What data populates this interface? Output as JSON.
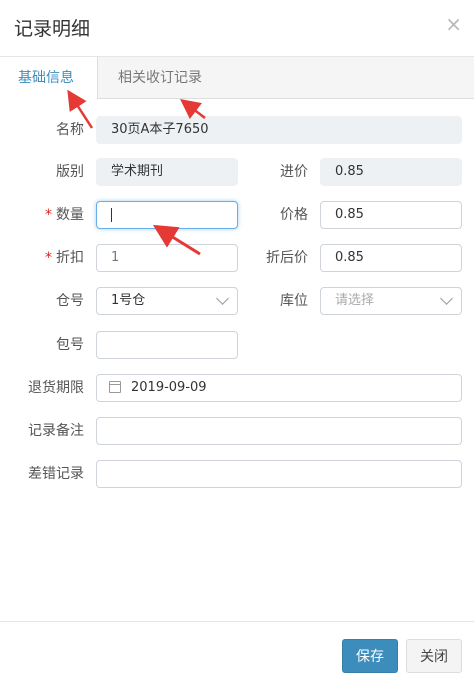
{
  "dialog": {
    "title": "记录明细",
    "close_glyph": "×"
  },
  "tabs": [
    {
      "label": "基础信息",
      "active": true
    },
    {
      "label": "相关收订记录",
      "active": false
    }
  ],
  "form": {
    "name_label": "名称",
    "name_value": "30页A本子7650",
    "edition_label": "版别",
    "edition_value": "学术期刊",
    "purchase_price_label": "进价",
    "purchase_price_value": "0.85",
    "required_mark": "*",
    "quantity_label": "数量",
    "quantity_value": "",
    "price_label": "价格",
    "price_value": "0.85",
    "discount_label": "折扣",
    "discount_value": "1",
    "discounted_price_label": "折后价",
    "discounted_price_value": "0.85",
    "warehouse_label": "仓号",
    "warehouse_value": "1号仓",
    "location_label": "库位",
    "location_placeholder": "请选择",
    "package_label": "包号",
    "package_value": "",
    "return_deadline_label": "退货期限",
    "return_deadline_value": "2019-09-09",
    "record_note_label": "记录备注",
    "record_note_value": "",
    "error_record_label": "差错记录",
    "error_record_value": ""
  },
  "footer": {
    "save_label": "保存",
    "close_label": "关闭"
  },
  "colors": {
    "accent": "#3c8dbc",
    "annotation_arrow": "#e53935",
    "required": "#e02020"
  }
}
